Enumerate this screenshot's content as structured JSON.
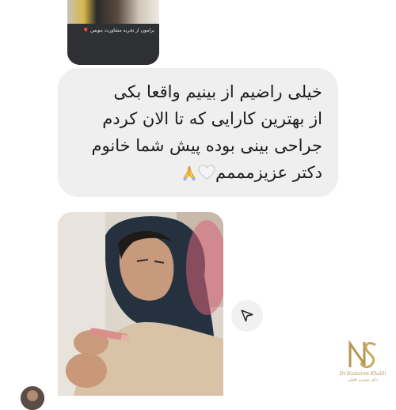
{
  "top_card": {
    "caption": "برامون از تجربه مشاورت بنویس 🎈"
  },
  "message": {
    "lines": [
      "خیلی راضیم از بینیم واقعا بکی",
      "از بهترین کارایی که تا الان کردم",
      "جراحی بینی بوده پیش شما خانوم",
      "دکتر عزیزمممم"
    ],
    "emojis": [
      "white-heart-icon",
      "folded-hands-icon"
    ],
    "bubble_color": "#efefef"
  },
  "watermark": {
    "name": "Dr.Nastaran Khalili",
    "subtitle": "دکتر نسترن خلیلی",
    "color": "#b59552"
  },
  "share": {
    "icon": "share-arrow-icon"
  }
}
